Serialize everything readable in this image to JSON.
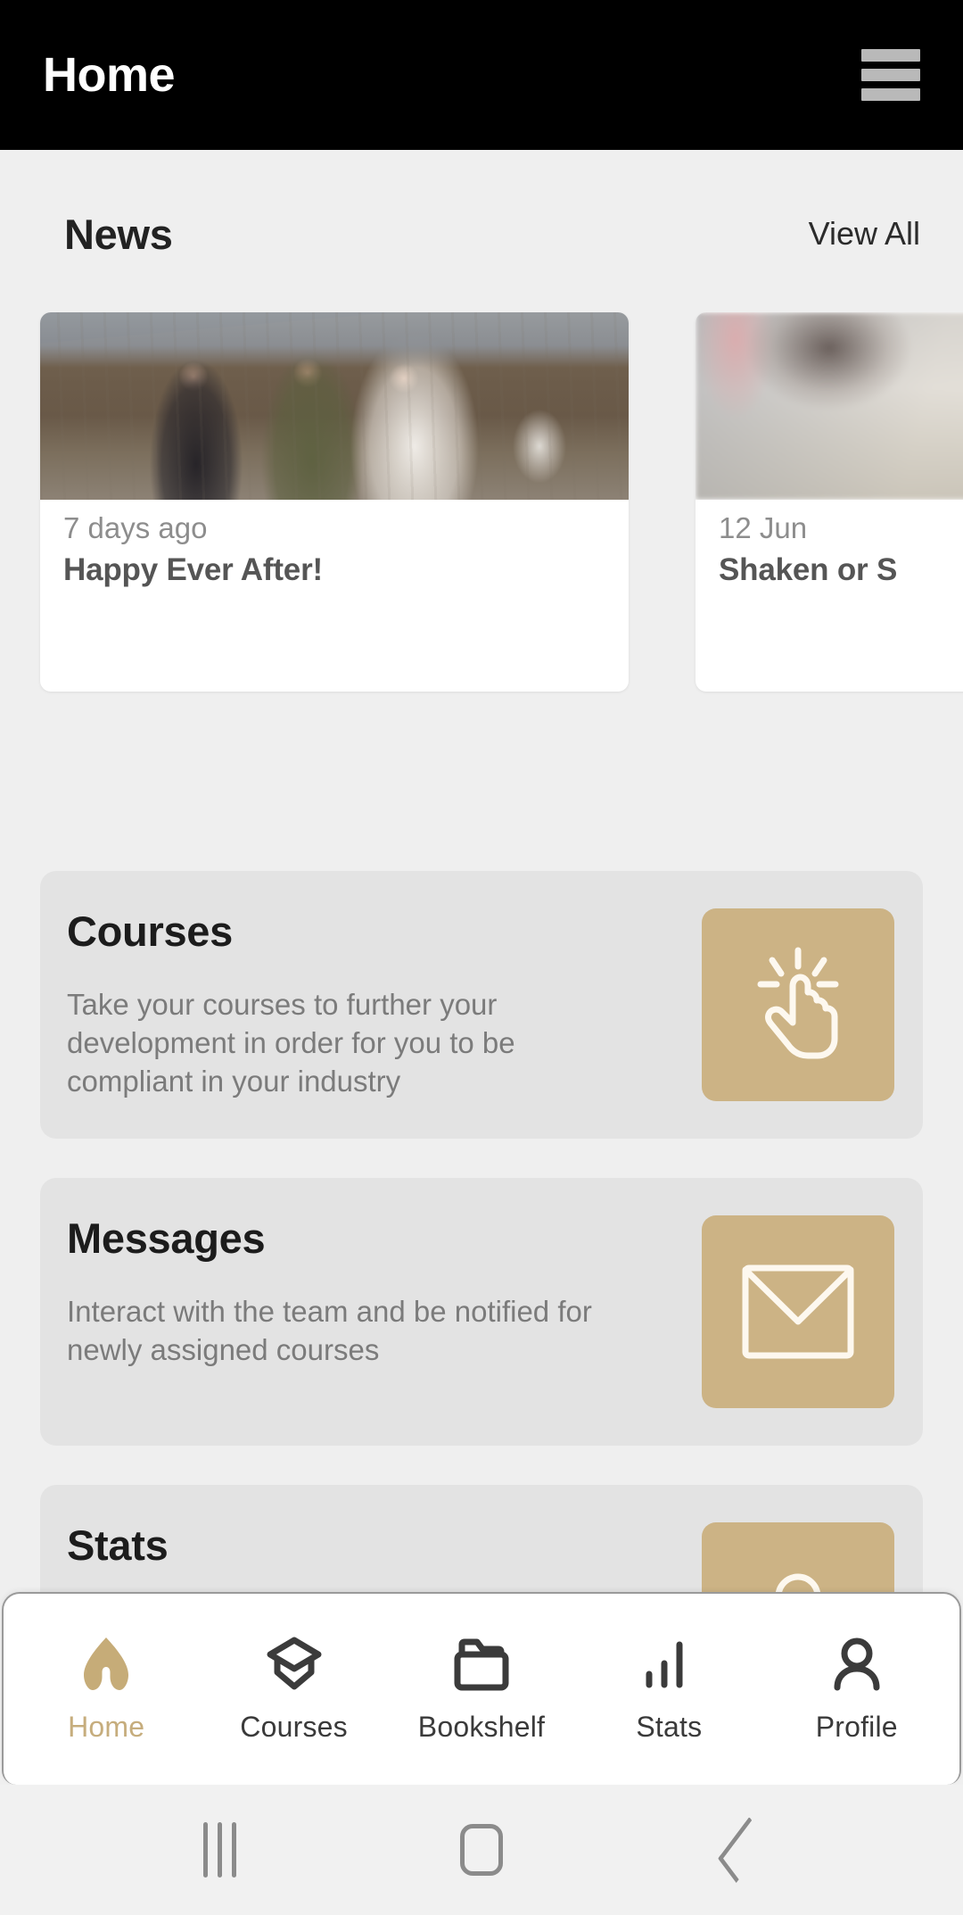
{
  "appbar": {
    "title": "Home",
    "menu_icon": "hamburger-menu-icon"
  },
  "news_section": {
    "title": "News",
    "view_all_label": "View All",
    "cards": [
      {
        "date": "7 days ago",
        "headline": "Happy Ever After!",
        "image_alt": "wedding-party-photo"
      },
      {
        "date": "12 Jun",
        "headline": "Shaken or S",
        "image_alt": "blurred-photo"
      }
    ]
  },
  "feature_cards": [
    {
      "title": "Courses",
      "description": "Take your courses to further your development in order for you to be compliant in your industry",
      "icon": "tap-hand-icon"
    },
    {
      "title": "Messages",
      "description": "Interact with the team and be notified for newly assigned courses",
      "icon": "envelope-icon"
    },
    {
      "title": "Stats",
      "description": "",
      "icon": "stats-icon"
    }
  ],
  "bottom_nav": {
    "items": [
      {
        "label": "Home",
        "icon": "home-arch-icon",
        "active": true
      },
      {
        "label": "Courses",
        "icon": "graduation-cap-icon",
        "active": false
      },
      {
        "label": "Bookshelf",
        "icon": "folder-icon",
        "active": false
      },
      {
        "label": "Stats",
        "icon": "bar-chart-icon",
        "active": false
      },
      {
        "label": "Profile",
        "icon": "person-icon",
        "active": false
      }
    ]
  },
  "system_nav": {
    "recents": "recents-icon",
    "home": "system-home-icon",
    "back": "back-icon"
  },
  "colors": {
    "accent": "#ccb385",
    "appbar_bg": "#000000",
    "page_bg": "#efefef",
    "card_bg": "#e3e3e3",
    "active_nav_label": "#c6ad7d"
  }
}
